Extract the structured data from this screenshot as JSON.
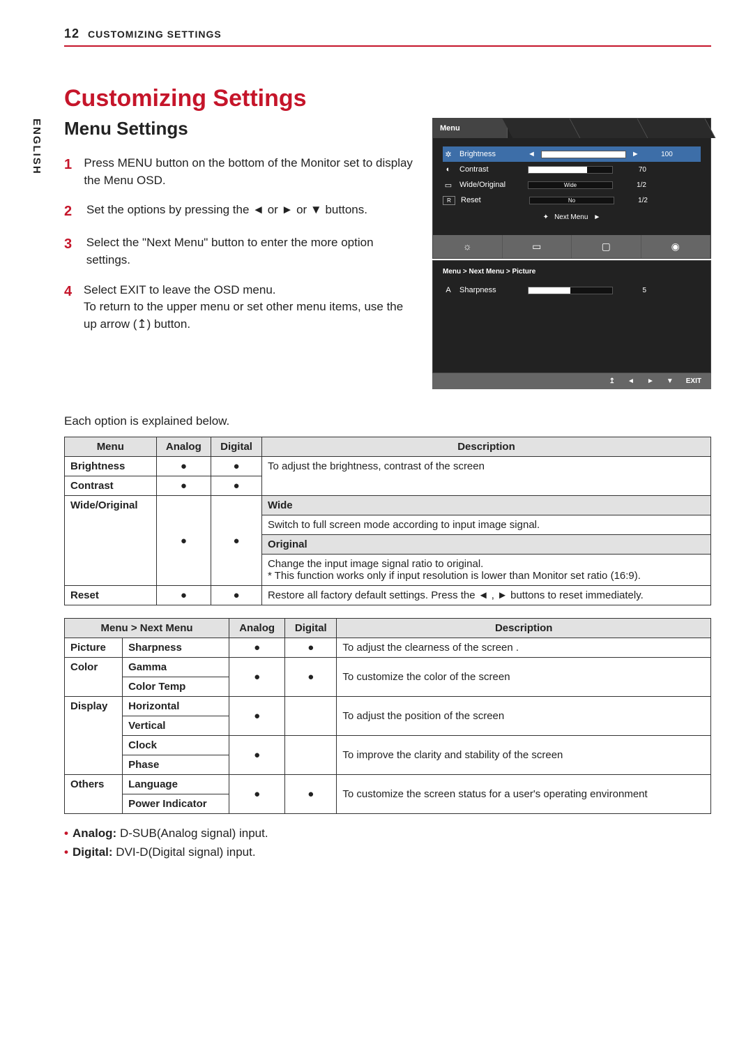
{
  "header": {
    "page_no": "12",
    "section": "CUSTOMIZING SETTINGS",
    "language_tab": "ENGLISH"
  },
  "titles": {
    "h1": "Customizing Settings",
    "h2": "Menu Settings"
  },
  "steps": [
    {
      "n": "1",
      "t": "Press MENU button on the bottom of the Monitor set to display the Menu OSD."
    },
    {
      "n": "2",
      "t": "Set the options by pressing the ◄ or ► or ▼ buttons."
    },
    {
      "n": "3",
      "t": "Select the \"Next Menu\" button to enter the more option settings."
    },
    {
      "n": "4",
      "t": "Select EXIT to leave the OSD menu.\nTo return to the upper menu or set other menu items, use the up arrow (↥) button."
    }
  ],
  "osd": {
    "tab": "Menu",
    "rows": [
      {
        "ic": "✲",
        "lb": "Brightness",
        "fill": 100,
        "val": "100",
        "hl": true,
        "arrows": true
      },
      {
        "ic": "◐",
        "lb": "Contrast",
        "fill": 70,
        "val": "70"
      },
      {
        "ic": "▭",
        "lb": "Wide/Original",
        "text": "Wide",
        "val": "1/2"
      },
      {
        "ic": "R",
        "lb": "Reset",
        "text": "No",
        "val": "1/2"
      }
    ],
    "next": "Next Menu",
    "icons": [
      "☼",
      "▭",
      "▢",
      "◉"
    ],
    "crumb": "Menu  >  Next Menu  >  Picture",
    "sub": {
      "ic": "A",
      "lb": "Sharpness",
      "fill": 50,
      "val": "5"
    },
    "btm": [
      "↥",
      "◄",
      "►",
      "▼",
      "EXIT"
    ]
  },
  "desc_intro": "Each option is explained below.",
  "table1": {
    "head": [
      "Menu",
      "Analog",
      "Digital",
      "Description"
    ],
    "brightness": "Brightness",
    "contrast": "Contrast",
    "bc_desc": "To adjust the brightness, contrast of the screen",
    "wo": "Wide/Original",
    "wide": "Wide",
    "wide_d": "Switch to full screen mode according to input image signal.",
    "orig": "Original",
    "orig_d": "Change the input image signal ratio to original.\n* This function works only if input resolution is lower than Monitor set ratio (16:9).",
    "reset": "Reset",
    "reset_d": "Restore all factory default settings. Press the ◄ , ► buttons to reset immediately."
  },
  "table2": {
    "head": [
      "Menu > Next Menu",
      "Analog",
      "Digital",
      "Description"
    ],
    "picture": "Picture",
    "sharp": "Sharpness",
    "sharp_d": "To adjust the clearness of the screen .",
    "color": "Color",
    "gamma": "Gamma",
    "ctemp": "Color Temp",
    "color_d": "To customize the color of the screen",
    "display": "Display",
    "horiz": "Horizontal",
    "vert": "Vertical",
    "pos_d": "To adjust the position of the screen",
    "clock": "Clock",
    "phase": "Phase",
    "clk_d": "To improve the clarity and stability of the screen",
    "others": "Others",
    "lang": "Language",
    "pind": "Power Indicator",
    "others_d": "To customize the screen status for a user's operating environment"
  },
  "notes": {
    "analog_l": "Analog:",
    "analog_t": " D-SUB(Analog signal) input.",
    "digital_l": "Digital:",
    "digital_t": " DVI-D(Digital signal) input."
  }
}
